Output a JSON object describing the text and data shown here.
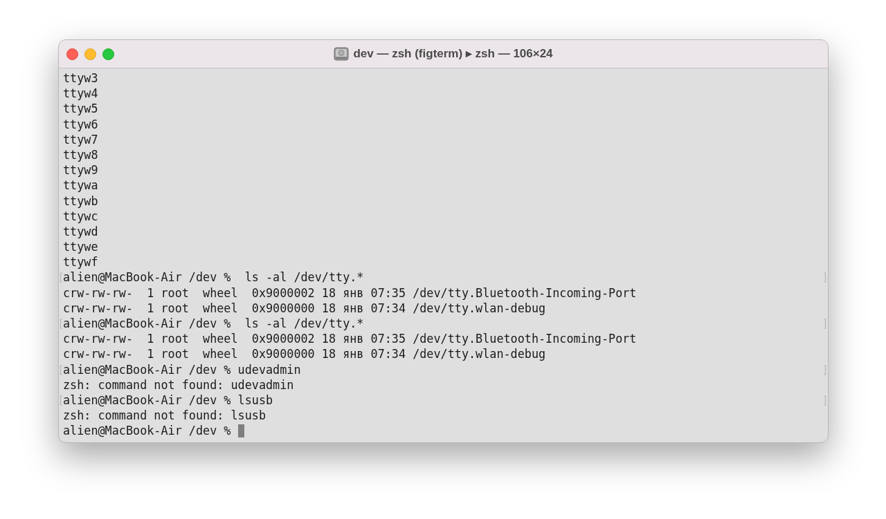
{
  "window": {
    "title": "dev — zsh (figterm) ▸ zsh — 106×24"
  },
  "lines": [
    {
      "kind": "output",
      "text": "ttyw3"
    },
    {
      "kind": "output",
      "text": "ttyw4"
    },
    {
      "kind": "output",
      "text": "ttyw5"
    },
    {
      "kind": "output",
      "text": "ttyw6"
    },
    {
      "kind": "output",
      "text": "ttyw7"
    },
    {
      "kind": "output",
      "text": "ttyw8"
    },
    {
      "kind": "output",
      "text": "ttyw9"
    },
    {
      "kind": "output",
      "text": "ttywa"
    },
    {
      "kind": "output",
      "text": "ttywb"
    },
    {
      "kind": "output",
      "text": "ttywc"
    },
    {
      "kind": "output",
      "text": "ttywd"
    },
    {
      "kind": "output",
      "text": "ttywe"
    },
    {
      "kind": "output",
      "text": "ttywf"
    },
    {
      "kind": "prompt",
      "text": "alien@MacBook-Air /dev %  ls -al /dev/tty.*"
    },
    {
      "kind": "output",
      "text": "crw-rw-rw-  1 root  wheel  0x9000002 18 янв 07:35 /dev/tty.Bluetooth-Incoming-Port"
    },
    {
      "kind": "output",
      "text": "crw-rw-rw-  1 root  wheel  0x9000000 18 янв 07:34 /dev/tty.wlan-debug"
    },
    {
      "kind": "prompt",
      "text": "alien@MacBook-Air /dev %  ls -al /dev/tty.*"
    },
    {
      "kind": "output",
      "text": "crw-rw-rw-  1 root  wheel  0x9000002 18 янв 07:35 /dev/tty.Bluetooth-Incoming-Port"
    },
    {
      "kind": "output",
      "text": "crw-rw-rw-  1 root  wheel  0x9000000 18 янв 07:34 /dev/tty.wlan-debug"
    },
    {
      "kind": "prompt",
      "text": "alien@MacBook-Air /dev % udevadmin"
    },
    {
      "kind": "output",
      "text": "zsh: command not found: udevadmin"
    },
    {
      "kind": "prompt",
      "text": "alien@MacBook-Air /dev % lsusb"
    },
    {
      "kind": "output",
      "text": "zsh: command not found: lsusb"
    },
    {
      "kind": "current",
      "text": "alien@MacBook-Air /dev % "
    }
  ]
}
